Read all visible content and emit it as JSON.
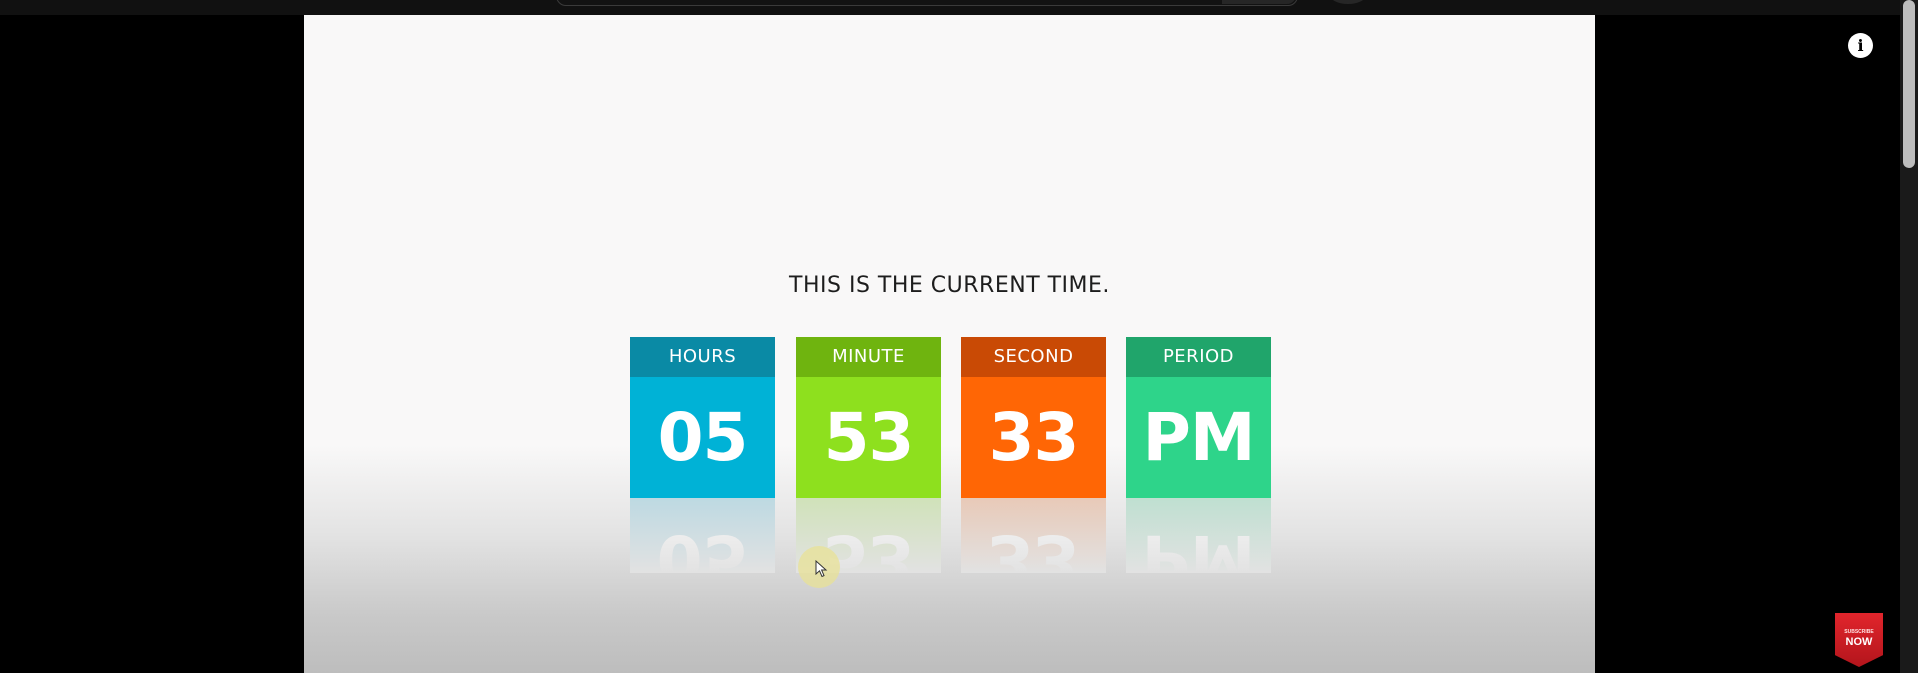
{
  "page": {
    "heading": "THIS IS THE CURRENT TIME."
  },
  "clock": [
    {
      "label": "HOURS",
      "value": "05",
      "label_color": "#0a8aa5",
      "value_color": "#00b2d6"
    },
    {
      "label": "MINUTE",
      "value": "53",
      "label_color": "#6fb40f",
      "value_color": "#8ee01e"
    },
    {
      "label": "SECOND",
      "value": "33",
      "label_color": "#c94a05",
      "value_color": "#ff6605"
    },
    {
      "label": "PERIOD",
      "value": "PM",
      "label_color": "#20a56b",
      "value_color": "#2ed48a"
    }
  ],
  "icons": {
    "info": "info-icon",
    "cursor": "mouse-cursor-icon",
    "subscribe": "subscribe-badge-icon"
  },
  "subscribe": {
    "small_text": "SUBSCRIBE",
    "big_text": "NOW"
  }
}
